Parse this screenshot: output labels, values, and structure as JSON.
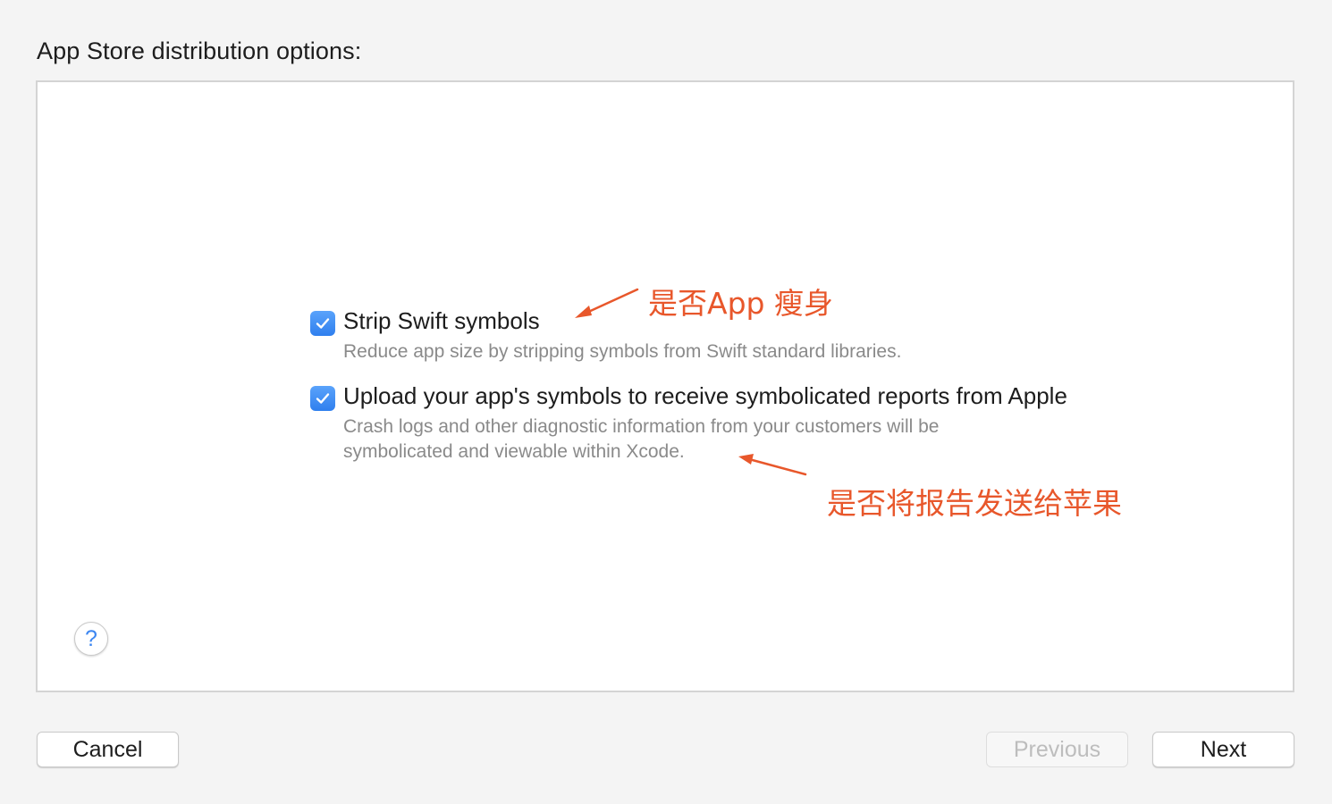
{
  "heading": "App Store distribution options:",
  "options": [
    {
      "title": "Strip Swift symbols",
      "description_lines": [
        "Reduce app size by stripping symbols from Swift standard libraries."
      ],
      "checked": true
    },
    {
      "title": "Upload your app's symbols to receive symbolicated reports from Apple",
      "description_lines": [
        "Crash logs and other diagnostic information from your customers will be",
        "symbolicated and viewable within Xcode."
      ],
      "checked": true
    }
  ],
  "annotations": {
    "strip": "是否App 瘦身",
    "upload": "是否将报告发送给苹果",
    "color": "#e8572b"
  },
  "help_button": {
    "label": "?",
    "icon": "question-mark-icon"
  },
  "buttons": {
    "cancel": "Cancel",
    "previous": "Previous",
    "next": "Next",
    "previous_enabled": false
  },
  "colors": {
    "accent": "#3d8df5",
    "panel_bg": "#ffffff",
    "window_bg": "#f4f4f4"
  }
}
